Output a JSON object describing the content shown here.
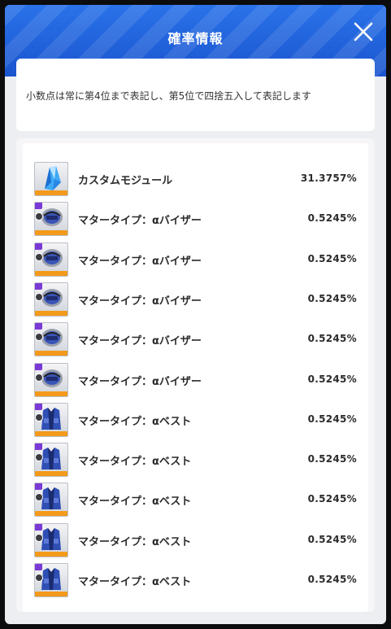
{
  "header": {
    "title": "確率情報"
  },
  "notice": {
    "text": "小数点は常に第4位まで表記し、第5位で四捨五入して表記します"
  },
  "items": [
    {
      "name": "カスタムモジュール",
      "rate": "31.3757%",
      "icon": "crystal-module-icon",
      "badge": ""
    },
    {
      "name": "マタータイプ：αバイザー",
      "rate": "0.5245%",
      "icon": "visor-icon",
      "badge": ""
    },
    {
      "name": "マタータイプ：αバイザー",
      "rate": "0.5245%",
      "icon": "visor-icon",
      "badge": ""
    },
    {
      "name": "マタータイプ：αバイザー",
      "rate": "0.5245%",
      "icon": "visor-icon",
      "badge": ""
    },
    {
      "name": "マタータイプ：αバイザー",
      "rate": "0.5245%",
      "icon": "visor-icon",
      "badge": ""
    },
    {
      "name": "マタータイプ：αバイザー",
      "rate": "0.5245%",
      "icon": "visor-icon",
      "badge": ""
    },
    {
      "name": "マタータイプ：αベスト",
      "rate": "0.5245%",
      "icon": "vest-icon",
      "badge": ""
    },
    {
      "name": "マタータイプ：αベスト",
      "rate": "0.5245%",
      "icon": "vest-icon",
      "badge": ""
    },
    {
      "name": "マタータイプ：αベスト",
      "rate": "0.5245%",
      "icon": "vest-icon",
      "badge": ""
    },
    {
      "name": "マタータイプ：αベスト",
      "rate": "0.5245%",
      "icon": "vest-icon",
      "badge": ""
    },
    {
      "name": "マタータイプ：αベスト",
      "rate": "0.5245%",
      "icon": "vest-icon",
      "badge": ""
    }
  ],
  "colors": {
    "header": "#1f5fd8",
    "badge": "#7b3ad6",
    "rarity_bar": "#f39a1a"
  }
}
